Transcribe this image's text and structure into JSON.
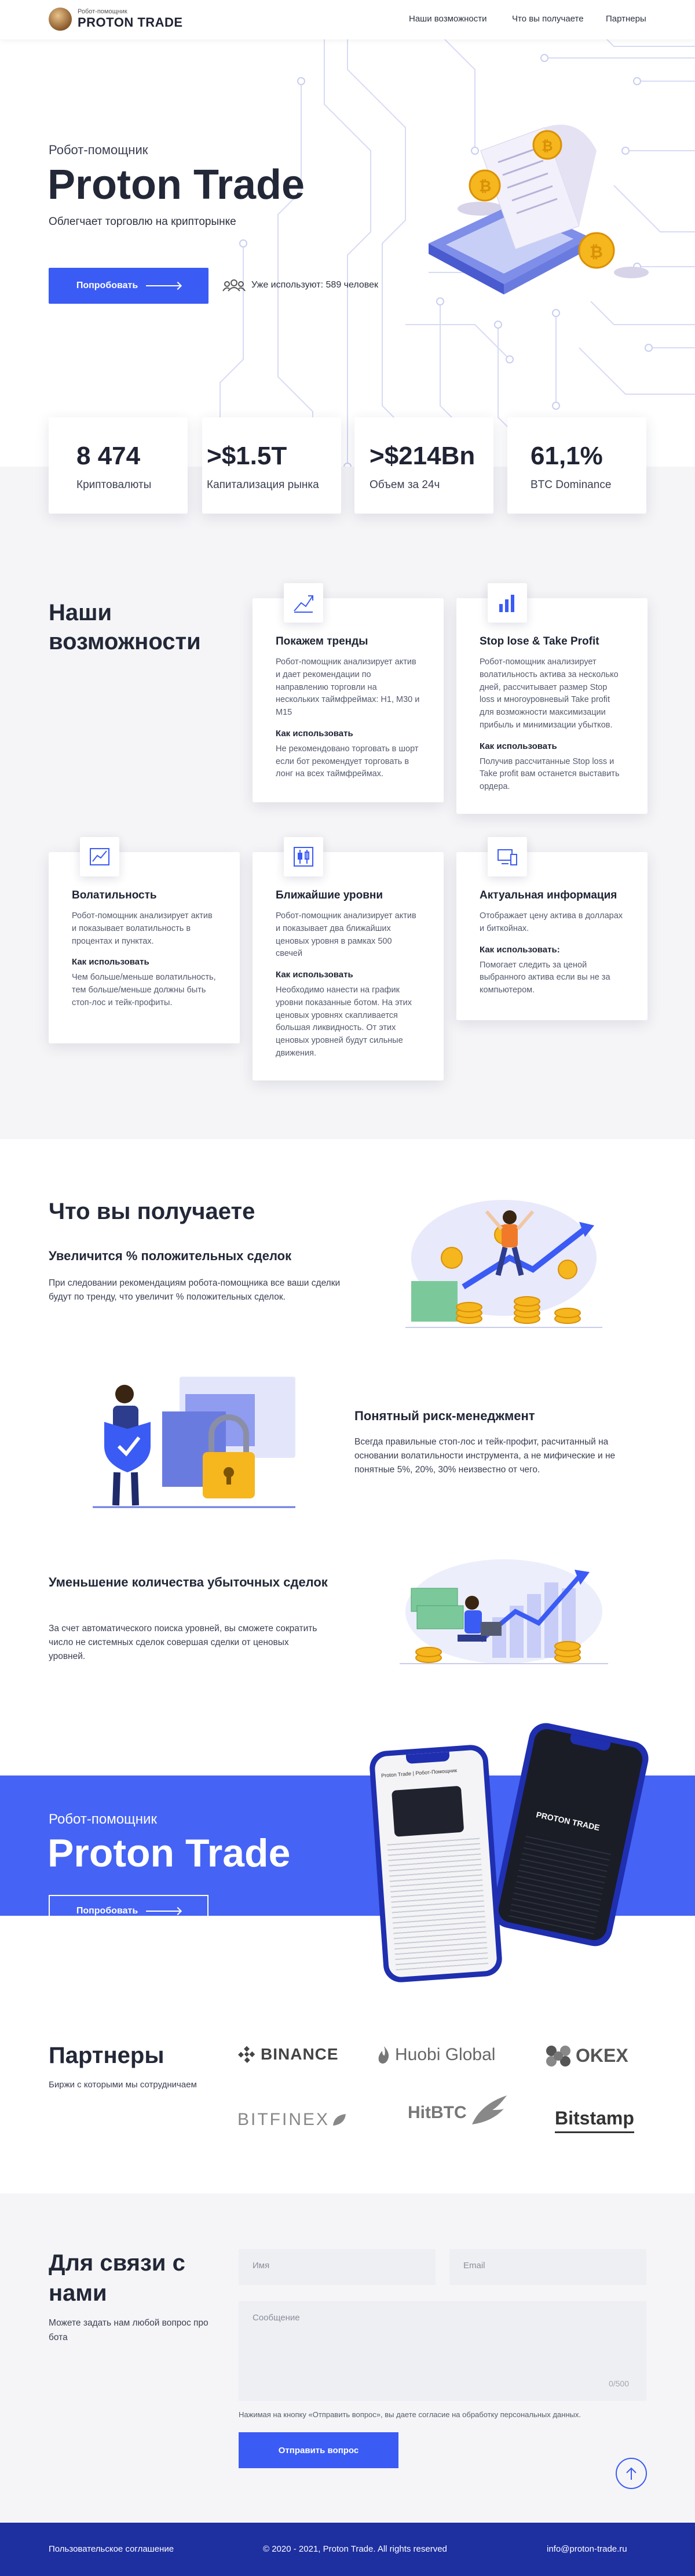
{
  "header": {
    "logo_small": "Робот-помощник",
    "logo_big": "PROTON TRADE",
    "nav": [
      "Наши возможности",
      "Что вы получаете",
      "Партнеры"
    ]
  },
  "hero": {
    "kicker": "Робот-помощник",
    "title": "Proton Trade",
    "subtitle": "Облегчает торговлю на крипторынке",
    "cta": "Попробовать",
    "users": "Уже используют: 589 человек"
  },
  "stats": [
    {
      "value": "8 474",
      "label": "Криптовалюты"
    },
    {
      "value": ">$1.5T",
      "label": "Капитализация рынка"
    },
    {
      "value": ">$214Bn",
      "label": "Объем за 24ч"
    },
    {
      "value": "61,1%",
      "label": "BTC Dominance"
    }
  ],
  "features": {
    "title": "Наши возможности",
    "items": [
      {
        "title": "Покажем тренды",
        "text": "Робот-помощник анализирует актив и дает рекомендации по направлению торговли на нескольких таймфреймах: Н1, М30 и М15",
        "how": "Как использовать",
        "how_text": "Не рекомендовано торговать в шорт если бот рекомендует торговать в лонг на всех таймфреймах."
      },
      {
        "title": "Stop lose & Take Profit",
        "text": "Робот-помощник анализирует волатильность актива за несколько дней, рассчитывает размер Stop loss и многоуровневый Take profit для возможности максимизации прибыль и минимизации убытков.",
        "how": "Как использовать",
        "how_text": "Получив рассчитанные Stop loss и Take profit вам останется выставить ордера."
      },
      {
        "title": "Волатильность",
        "text": "Робот-помощник анализирует актив и показывает волатильность в процентах и пунктах.",
        "how": "Как использовать",
        "how_text": "Чем больше/меньше волатильность, тем больше/меньше должны быть стоп-лос и тейк-профиты."
      },
      {
        "title": "Ближайшие уровни",
        "text": "Робот-помощник анализирует актив и показывает два ближайших ценовых уровня в рамках 500 свечей",
        "how": "Как использовать",
        "how_text": "Необходимо нанести на график уровни показанные ботом. На этих ценовых уровнях скапливается большая ликвидность. От этих ценовых уровней будут сильные движения."
      },
      {
        "title": "Актуальная информация",
        "text": "Отображает цену актива в долларах и биткойнах.",
        "how": "Как использовать:",
        "how_text": "Помогает следить за ценой выбранного актива если вы не за компьютером."
      }
    ]
  },
  "benefits": {
    "title": "Что вы получаете",
    "items": [
      {
        "title": "Увеличится % положительных сделок",
        "text": "При следовании рекомендациям робота-помощника все ваши сделки будут по тренду, что увеличит % положительных сделок."
      },
      {
        "title": "Понятный риск-менеджмент",
        "text": "Всегда правильные стоп-лос и тейк-профит, расчитанный на основании волатильности инструмента, а не мифические и не понятные 5%, 20%, 30% неизвестно от чего."
      },
      {
        "title": "Уменьшение количества убыточных сделок",
        "text": "За счет автоматического поиска уровней, вы сможете сократить число не системных сделок совершая сделки от ценовых уровней."
      }
    ]
  },
  "banner": {
    "kicker": "Робот-помощник",
    "title": "Proton Trade",
    "cta": "Попробовать",
    "phone1_header": "Proton Trade | Робот-Помощник",
    "phone2_logo": "PROTON TRADE"
  },
  "partners": {
    "title": "Партнеры",
    "subtitle": "Биржи с которыми мы сотрудничаем",
    "logos": [
      "BINANCE",
      "Huobi Global",
      "OKEX",
      "BITFINEX",
      "HitBTC",
      "Bitstamp"
    ]
  },
  "contact": {
    "title": "Для связи с нами",
    "subtitle": "Можете задать нам любой вопрос про бота",
    "name_ph": "Имя",
    "email_ph": "Email",
    "msg_ph": "Сообщение",
    "counter": "0/500",
    "consent": "Нажимая на кнопку «Отправить вопрос», вы даете согласие на обработку персональных данных.",
    "submit": "Отправить вопрос"
  },
  "footer": {
    "agreement": "Пользовательское соглашение",
    "copyright": "© 2020 - 2021, Proton Trade. All rights reserved",
    "email": "info@proton-trade.ru"
  },
  "colors": {
    "accent": "#3b5bf5",
    "footer": "#1e2fa0",
    "gold": "#f5b61e"
  }
}
